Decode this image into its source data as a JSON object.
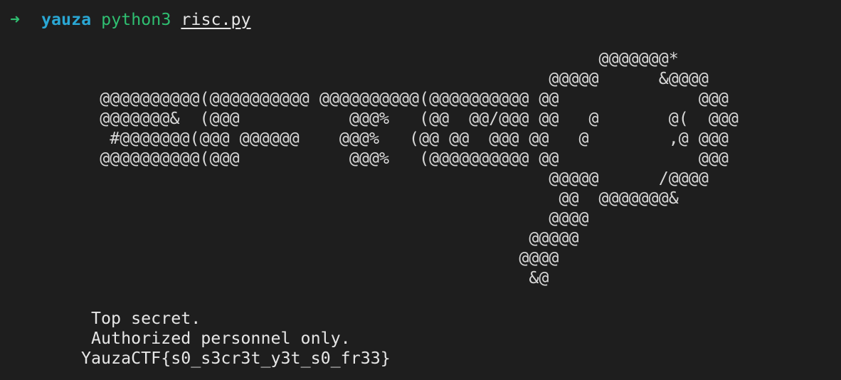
{
  "prompt": {
    "arrow": "➜",
    "directory": "yauza",
    "command": "python3",
    "argument": "risc.py"
  },
  "ascii_art": "                                                            @@@@@@@*\n                                                       @@@@@      &@@@@\n          @@@@@@@@@@(@@@@@@@@@@ @@@@@@@@@@(@@@@@@@@@@ @@              @@@\n          @@@@@@@&  (@@@           @@@%   (@@  @@/@@@ @@   @       @(  @@@\n           #@@@@@@@(@@@ @@@@@@    @@@%   (@@ @@  @@@ @@   @        ,@ @@@\n          @@@@@@@@@@(@@@           @@@%   (@@@@@@@@@@ @@              @@@\n                                                       @@@@@      /@@@@\n                                                        @@  @@@@@@@&\n                                                       @@@@\n                                                     @@@@@\n                                                    @@@@\n                                                     &@",
  "output": {
    "line1": "Top secret.",
    "line2": "Authorized personnel only.",
    "flag": "YauzaCTF{s0_s3cr3t_y3t_s0_fr33}"
  }
}
